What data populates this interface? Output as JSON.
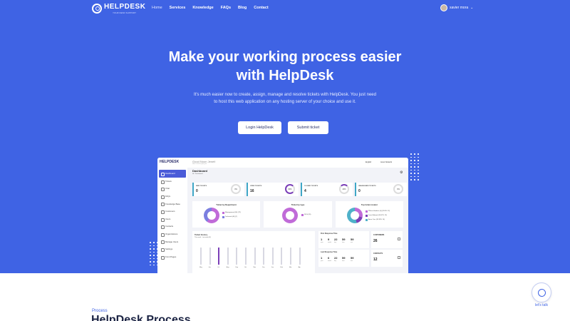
{
  "nav": {
    "brand": "HELPDESK",
    "brand_sub": "YOUR DESK SUPPORT",
    "links": [
      "Home",
      "Services",
      "Knowledge",
      "FAQs",
      "Blog",
      "Contact"
    ],
    "user_name": "xavier mora"
  },
  "hero": {
    "title_line1": "Make your working process easier",
    "title_line2": "with HelpDesk",
    "subtitle": "It's much easier now to create, assign, manage and resolve tickets with HelpDesk. You just need to host this web application on any hosting server of your choice and use it.",
    "login_label": "Login HelpDesk",
    "submit_label": "Submit ticket"
  },
  "dashboard": {
    "brand": "HELPDESK",
    "greeting": "Good Noon Jenet!",
    "greeting_sub": "Here's what's going on",
    "language": "English",
    "user": "Jenet Network",
    "title": "Dashboard",
    "crumb": "Hi / Dashboard",
    "menu": [
      "Dashboard",
      "Tickets",
      "Chat",
      "FAQs",
      "Knowledge Base",
      "Customers",
      "Users",
      "Contacts",
      "Organizations",
      "Manage Users",
      "Settings",
      "Front Pages"
    ],
    "stats": [
      {
        "label": "NEW TICKETS",
        "value": "0",
        "pct": "0%"
      },
      {
        "label": "OPEN TICKETS",
        "value": "16",
        "pct": "80%"
      },
      {
        "label": "CLOSED TICKETS",
        "value": "4",
        "pct": "20%"
      },
      {
        "label": "UNASSIGNED TICKETS",
        "value": "0",
        "pct": "0%"
      }
    ],
    "cards": [
      {
        "title": "Ticket by Department",
        "legend": [
          "Management (60) (72)",
          "Technical (40) (7)"
        ]
      },
      {
        "title": "Ticket by type",
        "legend": [
          "DDG (20)"
        ]
      },
      {
        "title": "Top ticket creator",
        "legend": [
          "Wilson Howkins (4) (28.6% 12)",
          "Jenet Edward (16.67% 13)",
          "Anne Cars (33.33% 14)"
        ]
      }
    ],
    "history": {
      "title": "Ticket history",
      "legend_items": [
        "This week",
        "Last week (8)"
      ],
      "months": [
        "May",
        "Jun",
        "Jul",
        "Aug",
        "Sep",
        "Oct",
        "Nov",
        "Dec",
        "Jan",
        "Feb",
        "Mar",
        "Apr"
      ]
    },
    "first_response": {
      "title": "First Response Time",
      "values": [
        "1",
        "9",
        "22",
        "59",
        "59"
      ],
      "units": [
        "year",
        "month",
        "day",
        "hour",
        "min"
      ]
    },
    "last_response": {
      "title": "Last Response Time",
      "values": [
        "1",
        "6",
        "22",
        "59",
        "59"
      ],
      "units": [
        "year",
        "month",
        "day",
        "hour",
        "min"
      ]
    },
    "customers": {
      "label": "CUSTOMERS",
      "value": "26"
    },
    "contacts": {
      "label": "CONTACTS",
      "value": "12"
    }
  },
  "process": {
    "label": "Process",
    "title": "HelpDesk Process"
  },
  "chat": {
    "label": "let's talk"
  },
  "colors": {
    "hero": "#3f63e4",
    "accent": "#7b3fb8",
    "teal": "#3fa7c7"
  }
}
